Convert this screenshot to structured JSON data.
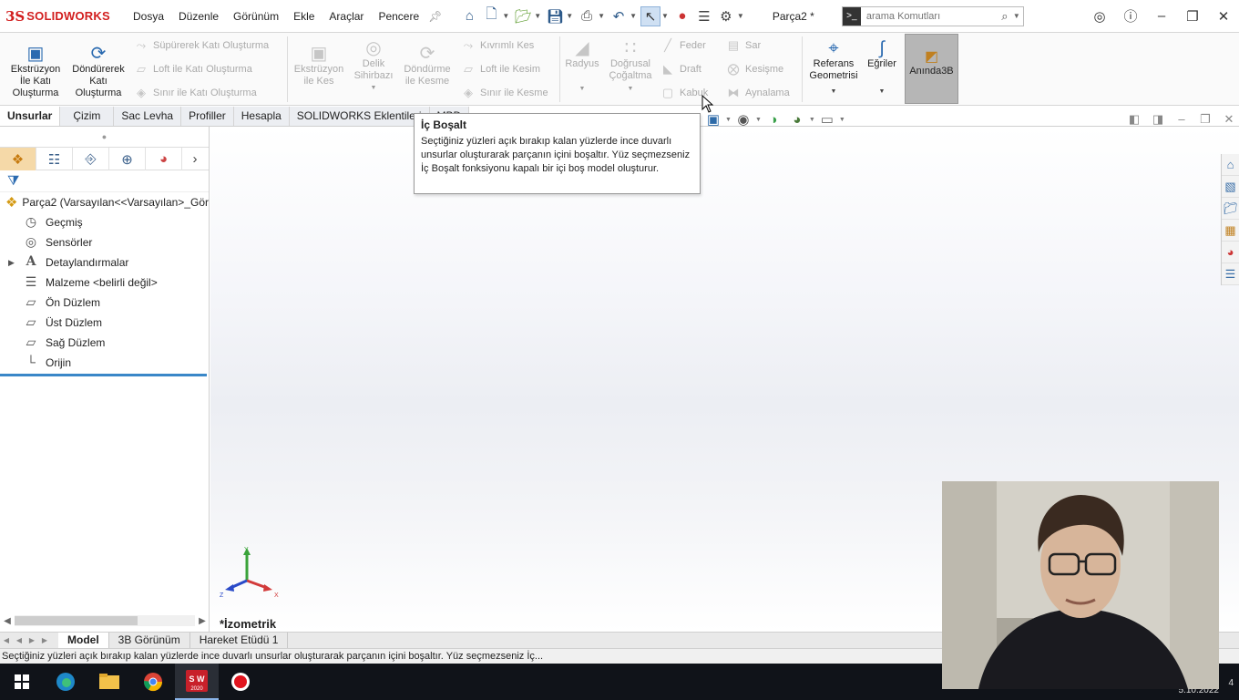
{
  "app": {
    "brand": "SOLIDWORKS",
    "logo_mark": "3S",
    "doc_title": "Parça2 *"
  },
  "menu": [
    "Dosya",
    "Düzenle",
    "Görünüm",
    "Ekle",
    "Araçlar",
    "Pencere"
  ],
  "search": {
    "placeholder": "arama Komutları"
  },
  "ribbon": {
    "extrude_boss": "Ekstrüzyon İle Katı Oluşturma",
    "revolve_boss": "Döndürerek Katı Oluşturma",
    "sweep_boss": "Süpürerek Katı Oluşturma",
    "loft_boss": "Loft ile Katı Oluşturma",
    "boundary_boss": "Sınır ile Katı Oluşturma",
    "extrude_cut": "Ekstrüzyon ile Kes",
    "hole_wizard": "Delik Sihirbazı",
    "revolve_cut": "Döndürme ile Kesme",
    "swept_cut": "Kıvrımlı Kes",
    "loft_cut": "Loft ile Kesim",
    "boundary_cut": "Sınır ile Kesme",
    "fillet": "Radyus",
    "linear_pattern": "Doğrusal Çoğaltma",
    "rib": "Feder",
    "draft": "Draft",
    "shell": "Kabuk",
    "wrap": "Sar",
    "intersect": "Kesişme",
    "mirror": "Aynalama",
    "ref_geometry": "Referans Geometrisi",
    "curves": "Eğriler",
    "instant3d": "Anında3B"
  },
  "tabs": [
    "Unsurlar",
    "Çizim",
    "Sac Levha",
    "Profiller",
    "Hesapla",
    "SOLIDWORKS Eklentileri",
    "MBD"
  ],
  "tree": {
    "root": "Parça2  (Varsayılan<<Varsayılan>_Gör",
    "items": [
      "Geçmiş",
      "Sensörler",
      "Detaylandırmalar",
      "Malzeme <belirli değil>",
      "Ön Düzlem",
      "Üst Düzlem",
      "Sağ Düzlem",
      "Orijin"
    ]
  },
  "tooltip": {
    "title": "İç Boşalt",
    "body": "Seçtiğiniz yüzleri açık bırakıp kalan yüzlerde ince duvarlı unsurlar oluşturarak parçanın içini boşaltır. Yüz seçmezseniz İç Boşalt fonksiyonu kapalı bir içi boş model oluşturur."
  },
  "viewport": {
    "view_name": "*İzometrik",
    "axis_x": "X",
    "axis_y": "Y",
    "axis_z": "Z"
  },
  "model_tabs": [
    "Model",
    "3B Görünüm",
    "Hareket Etüdü 1"
  ],
  "status": "Seçtiğiniz yüzleri açık bırakıp kalan yüzlerde ince duvarlı unsurlar oluşturarak parçanın içini boşaltır. Yüz seçmezseniz İç...",
  "taskbar": {
    "date": "5.10.2022",
    "notification_count": "4",
    "sw_badge": "2020"
  }
}
